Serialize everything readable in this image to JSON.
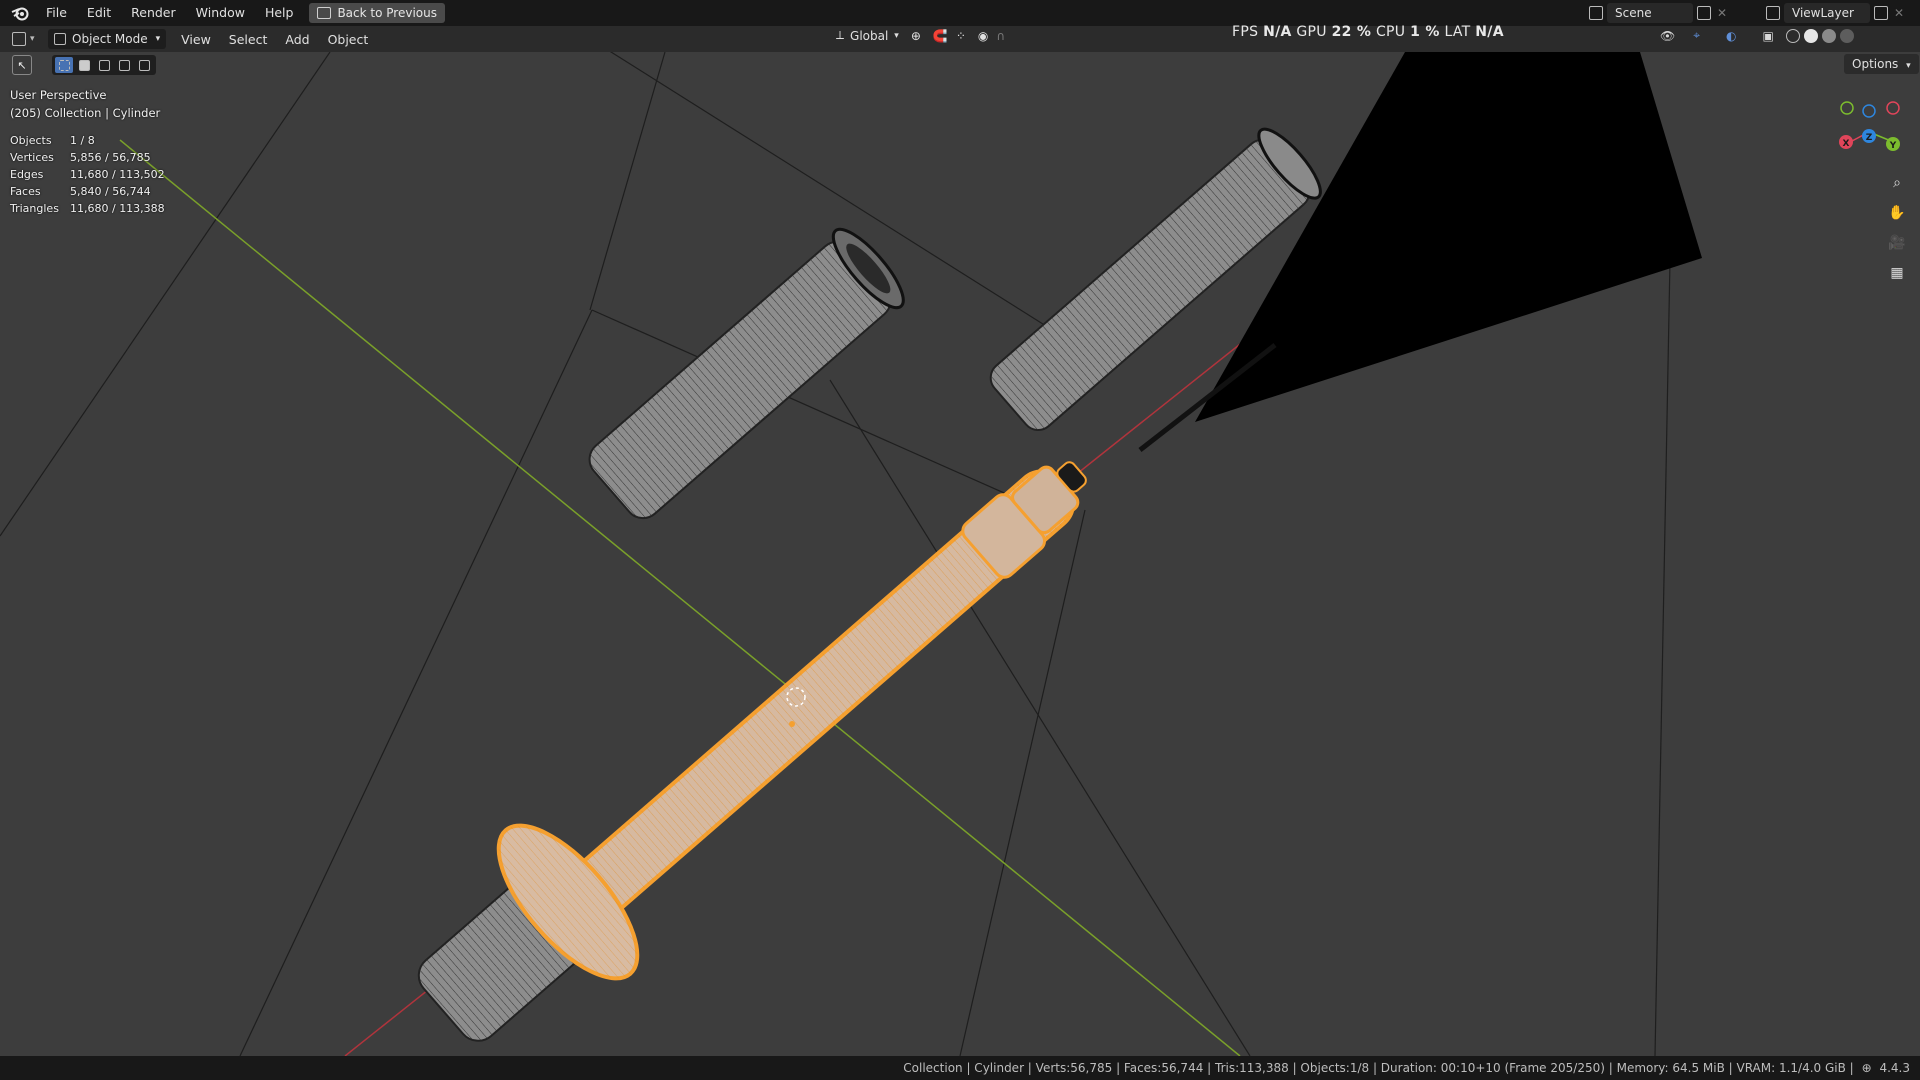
{
  "app": {
    "logo_icon": "blender-logo-icon"
  },
  "topbar": {
    "menus": [
      "File",
      "Edit",
      "Render",
      "Window",
      "Help"
    ],
    "back_button": "Back to Previous",
    "scene": "Scene",
    "view_layer": "ViewLayer"
  },
  "header": {
    "mode": "Object Mode",
    "menus": [
      "View",
      "Select",
      "Add",
      "Object"
    ],
    "orientation": "Global",
    "options": "Options"
  },
  "perf": {
    "fps_label": "FPS",
    "fps_value": "N/A",
    "gpu_label": "GPU",
    "gpu_value": "22 %",
    "cpu_label": "CPU",
    "cpu_value": "1 %",
    "lat_label": "LAT",
    "lat_value": "N/A"
  },
  "overlay": {
    "view_name": "User Perspective",
    "collection_line": "(205) Collection | Cylinder"
  },
  "stats": [
    {
      "label": "Objects",
      "value": "1 / 8"
    },
    {
      "label": "Vertices",
      "value": "5,856 / 56,785"
    },
    {
      "label": "Edges",
      "value": "11,680 / 113,502"
    },
    {
      "label": "Faces",
      "value": "5,840 / 56,744"
    },
    {
      "label": "Triangles",
      "value": "11,680 / 113,388"
    }
  ],
  "gizmo": {
    "x": "X",
    "y": "Y",
    "z": "Z",
    "x_color": "#e0455a",
    "y_color": "#7cbc2e",
    "z_color": "#2e86de"
  },
  "statusbar": {
    "text": "Collection | Cylinder | Verts:56,785 | Faces:56,744 | Tris:113,388 | Objects:1/8 | Duration: 00:10+10 (Frame 205/250) | Memory: 64.5 MiB | VRAM: 1.1/4.0 GiB |",
    "version": "4.4.3"
  },
  "colors": {
    "selection": "#f5a030",
    "x_axis": "#b0343c",
    "y_axis": "#7aa02a",
    "background": "#3d3d3d"
  }
}
